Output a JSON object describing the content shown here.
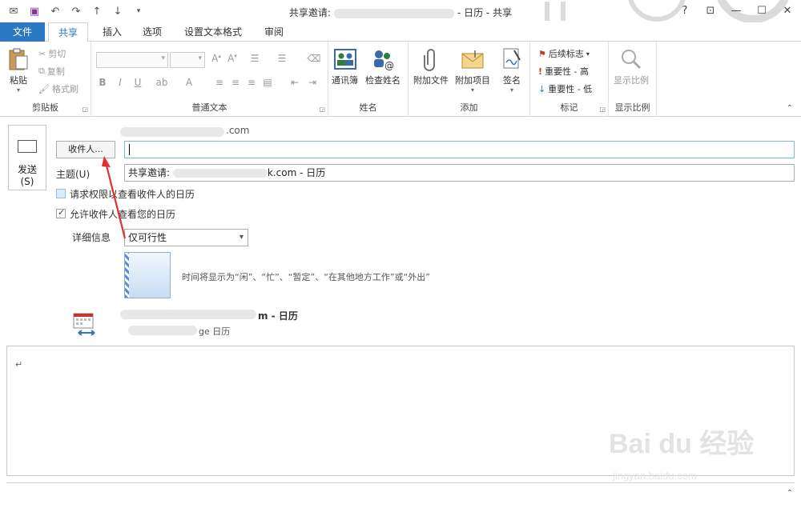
{
  "window": {
    "title_prefix": "共享邀请:",
    "title_suffix": "- 日历 - 共享",
    "help": "?",
    "controls": [
      "?",
      "⊡",
      "—",
      "☐",
      "✕"
    ]
  },
  "qat": {
    "icons": [
      "mail-icon",
      "save-icon",
      "undo-icon",
      "redo-icon",
      "up-icon",
      "down-icon",
      "customize-icon"
    ]
  },
  "tabs": {
    "file": "文件",
    "share": "共享",
    "insert": "插入",
    "options": "选项",
    "format": "设置文本格式",
    "review": "审阅"
  },
  "ribbon": {
    "clipboard": {
      "label": "剪贴板",
      "paste": "粘贴",
      "cut": "剪切",
      "copy": "复制",
      "format_painter": "格式刷"
    },
    "basic_text": {
      "label": "普通文本"
    },
    "names": {
      "label": "姓名",
      "address_book": "通讯簿",
      "check_names": "检查姓名"
    },
    "include": {
      "label": "添加",
      "attach_file": "附加文件",
      "attach_item": "附加项目",
      "signature": "签名"
    },
    "tags": {
      "label": "标记",
      "follow_up": "后续标志",
      "high": "重要性 - 高",
      "low": "重要性 - 低"
    },
    "zoom": {
      "label": "显示比例",
      "zoom": "显示比例"
    }
  },
  "form": {
    "from_suffix": ".com",
    "send": "发送",
    "send_key": "(S)",
    "to_button": "收件人...",
    "to_value": "",
    "subject_label": "主题(U)",
    "subject_prefix": "共享邀请: ",
    "subject_suffix": "k.com - 日历",
    "request_permission": "请求权限以查看收件人的日历",
    "allow_view": "允许收件人查看您的日历",
    "allow_view_checked": true,
    "details_label": "详细信息",
    "details_value": "仅可行性",
    "details_desc": "时间将显示为“闲”、“忙”、“暂定”、“在其他地方工作”或“外出”",
    "calendar_name_suffix": "m - 日历",
    "calendar_sub_suffix": "ge 日历",
    "body_mark": "↵"
  },
  "watermark": {
    "logo": "Bai du 经验",
    "url": "jingyan.baidu.com"
  }
}
